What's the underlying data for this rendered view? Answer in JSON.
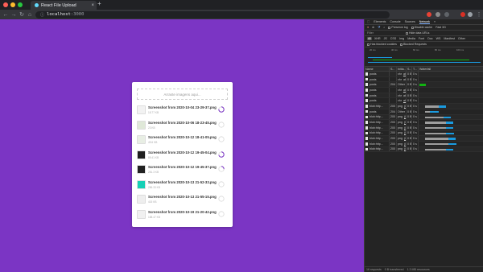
{
  "browser": {
    "tab_title": "React File Upload",
    "url_host": "localhost",
    "url_port": ":3000",
    "colors": {
      "close": "#ff5f57",
      "minimize": "#febc2e",
      "maximize": "#28c840"
    }
  },
  "app": {
    "background": "#7b35c4",
    "drop_placeholder": "Arraste imagens aqui...",
    "files": [
      {
        "name": "Screenshot from 2020-10-04 23-29-37.png",
        "size": "18.77 KB",
        "thumb": "#f2f2f2",
        "progress": 0.75
      },
      {
        "name": "Screenshot from 2020-10-06 18-23-45.png",
        "size": "23 KB",
        "thumb": "#dfe8d8",
        "progress": 0.0
      },
      {
        "name": "Screenshot from 2020-10-12 18-41-05.png",
        "size": "49.6 KB",
        "thumb": "#e8eee4",
        "progress": 0.0
      },
      {
        "name": "Screenshot from 2020-10-12 19-45-04.png",
        "size": "89.41 KB",
        "thumb": "#1e1e1e",
        "progress": 0.7
      },
      {
        "name": "Screenshot from 2020-10-12 19-45-37.png",
        "size": "281.3 KB",
        "thumb": "#222222",
        "progress": 0.25
      },
      {
        "name": "Screenshot from 2020-10-13 21-52-33.png",
        "size": "286.33 KB",
        "thumb": "#17d0b6",
        "progress": 0.0
      },
      {
        "name": "Screenshot from 2020-10-13 21-55-15.png",
        "size": "415 KB",
        "thumb": "#eeeeee",
        "progress": 0.0
      },
      {
        "name": "Screenshot from 2020-10-19 21-20-42.png",
        "size": "188.47 KB",
        "thumb": "#f0f0f0",
        "progress": 0.0
      }
    ]
  },
  "devtools": {
    "tabs": [
      "Elements",
      "Console",
      "Sources",
      "Network",
      "»"
    ],
    "active_tab": "Network",
    "controls": {
      "preserve_log": "Preserve log",
      "disable_cache": "Disable cache",
      "throttle": "Fast 3G"
    },
    "filter_label": "Filter",
    "hide_data_urls": "Hide data URLs",
    "filter_types": [
      "All",
      "XHR",
      "JS",
      "CSS",
      "Img",
      "Media",
      "Font",
      "Doc",
      "WS",
      "Manifest",
      "Other"
    ],
    "blocked_cookies": "Has blocked cookies",
    "blocked_requests": "Blocked Requests",
    "overview_ticks": [
      "20 ms",
      "40 ms",
      "60 ms",
      "80 ms",
      "100 ms"
    ],
    "columns": [
      "Name",
      "S...",
      "Initia...",
      "S...",
      "T...",
      "Waterfall"
    ],
    "rows": [
      {
        "name": "posts",
        "status": "",
        "init": "xhr",
        "initlink": "abcio...",
        "size": "0 B",
        "time": "0 s",
        "wf": null
      },
      {
        "name": "posts",
        "status": "",
        "init": "xhr",
        "initlink": "abcio...",
        "size": "0 B",
        "time": "0 s",
        "wf": null
      },
      {
        "name": "posts",
        "status": "204",
        "init": "Other",
        "initlink": "",
        "size": "0 B",
        "time": "0 s",
        "wf": {
          "green": [
            0.02,
            0.15
          ]
        }
      },
      {
        "name": "posts",
        "status": "",
        "init": "xhr",
        "initlink": "abcio...",
        "size": "0 B",
        "time": "0 s",
        "wf": null
      },
      {
        "name": "posts",
        "status": "",
        "init": "xhr",
        "initlink": "abcio...",
        "size": "0 B",
        "time": "0 s",
        "wf": null
      },
      {
        "name": "posts",
        "status": "",
        "init": "xhr",
        "initlink": "abcio...",
        "size": "0 B",
        "time": "0 s",
        "wf": null
      },
      {
        "name": "blob:http...",
        "status": "200",
        "init": "png",
        "initlink": "(index)",
        "size": "0 B",
        "time": "0 s",
        "wf": {
          "wait": [
            0.0,
            0.3
          ],
          "dl": [
            0.3,
            0.45
          ]
        }
      },
      {
        "name": "posts",
        "status": "204",
        "init": "Other",
        "initlink": "",
        "size": "0 B",
        "time": "0 s",
        "wf": {
          "wait": [
            0.0,
            0.1
          ],
          "dl": [
            0.1,
            0.3
          ]
        }
      },
      {
        "name": "blob:http...",
        "status": "200",
        "init": "png",
        "initlink": "(index)",
        "size": "0 B",
        "time": "0 s",
        "wf": {
          "wait": [
            0.0,
            0.4
          ],
          "dl": [
            0.4,
            0.55
          ]
        }
      },
      {
        "name": "blob:http...",
        "status": "200",
        "init": "png",
        "initlink": "(index)",
        "size": "0 B",
        "time": "0 s",
        "wf": {
          "wait": [
            0.0,
            0.45
          ],
          "dl": [
            0.45,
            0.6
          ]
        }
      },
      {
        "name": "blob:http...",
        "status": "200",
        "init": "png",
        "initlink": "(index)",
        "size": "0 B",
        "time": "0 s",
        "wf": {
          "wait": [
            0.0,
            0.45
          ],
          "dl": [
            0.45,
            0.6
          ]
        }
      },
      {
        "name": "blob:http...",
        "status": "200",
        "init": "png",
        "initlink": "(index)",
        "size": "0 B",
        "time": "0 s",
        "wf": {
          "wait": [
            0.0,
            0.45
          ],
          "dl": [
            0.45,
            0.62
          ]
        }
      },
      {
        "name": "blob:http...",
        "status": "200",
        "init": "png",
        "initlink": "(index)",
        "size": "0 B",
        "time": "0 s",
        "wf": {
          "wait": [
            0.0,
            0.5
          ],
          "dl": [
            0.5,
            0.65
          ]
        }
      },
      {
        "name": "blob:http...",
        "status": "200",
        "init": "png",
        "initlink": "(index)",
        "size": "0 B",
        "time": "0 s",
        "wf": {
          "wait": [
            0.0,
            0.5
          ],
          "dl": [
            0.5,
            0.68
          ]
        }
      },
      {
        "name": "blob:http...",
        "status": "200",
        "init": "png",
        "initlink": "(index)",
        "size": "0 B",
        "time": "0 s",
        "wf": {
          "wait": [
            0.0,
            0.45
          ],
          "dl": [
            0.45,
            0.6
          ]
        }
      }
    ],
    "footer": {
      "requests": "16 requests",
      "transferred": "0 B transferred",
      "resources": "1.3 MB resources"
    }
  }
}
